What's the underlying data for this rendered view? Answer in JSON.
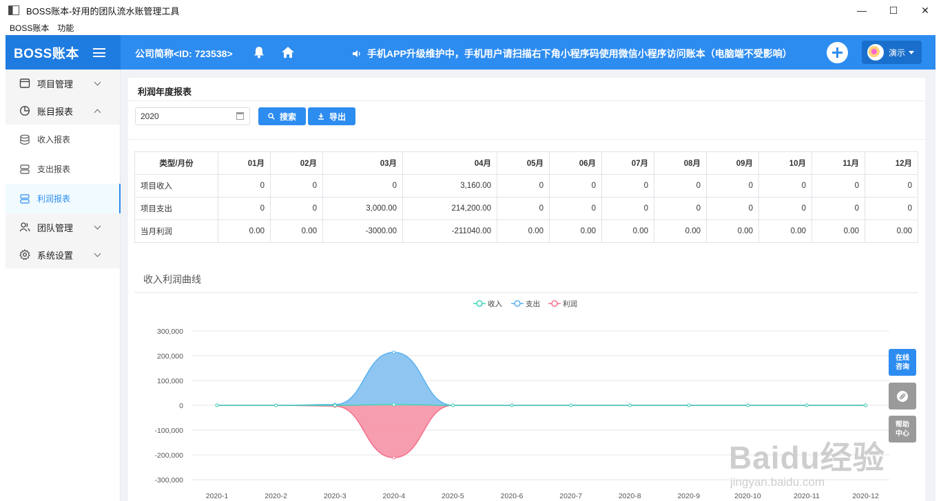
{
  "window": {
    "title": "BOSS账本-好用的团队流水账管理工具",
    "menu": [
      "BOSS账本",
      "功能"
    ],
    "controls": [
      "—",
      "☐",
      "✕"
    ]
  },
  "header": {
    "logo": "BOSS账本",
    "company": "公司简称<ID: 723538>",
    "notice": "手机APP升级维护中，手机用户请扫描右下角小程序码使用微信小程序访问账本（电脑端不受影响）",
    "user": "演示"
  },
  "sidebar": {
    "groups": [
      {
        "label": "项目管理"
      },
      {
        "label": "账目报表"
      },
      {
        "label": "团队管理"
      },
      {
        "label": "系统设置"
      }
    ],
    "sub_items": [
      {
        "label": "收入报表"
      },
      {
        "label": "支出报表"
      },
      {
        "label": "利润报表"
      }
    ]
  },
  "page": {
    "title": "利润年度报表",
    "year_value": "2020",
    "search_label": "搜索",
    "export_label": "导出"
  },
  "table": {
    "headers": [
      "类型/月份",
      "01月",
      "02月",
      "03月",
      "04月",
      "05月",
      "06月",
      "07月",
      "08月",
      "09月",
      "10月",
      "11月",
      "12月"
    ],
    "rows": [
      [
        "项目收入",
        "0",
        "0",
        "0",
        "3,160.00",
        "0",
        "0",
        "0",
        "0",
        "0",
        "0",
        "0",
        "0"
      ],
      [
        "项目支出",
        "0",
        "0",
        "3,000.00",
        "214,200.00",
        "0",
        "0",
        "0",
        "0",
        "0",
        "0",
        "0",
        "0"
      ],
      [
        "当月利润",
        "0.00",
        "0.00",
        "-3000.00",
        "-211040.00",
        "0.00",
        "0.00",
        "0.00",
        "0.00",
        "0.00",
        "0.00",
        "0.00",
        "0.00"
      ]
    ]
  },
  "chart_title": "收入利润曲线",
  "chart_data": {
    "type": "area",
    "categories": [
      "2020-1",
      "2020-2",
      "2020-3",
      "2020-4",
      "2020-5",
      "2020-6",
      "2020-7",
      "2020-8",
      "2020-9",
      "2020-10",
      "2020-11",
      "2020-12"
    ],
    "series": [
      {
        "name": "收入",
        "color": "#3fd3b8",
        "values": [
          0,
          0,
          0,
          3160,
          0,
          0,
          0,
          0,
          0,
          0,
          0,
          0
        ]
      },
      {
        "name": "支出",
        "color": "#5ab1ef",
        "values": [
          0,
          0,
          3000,
          214200,
          0,
          0,
          0,
          0,
          0,
          0,
          0,
          0
        ]
      },
      {
        "name": "利润",
        "color": "#f4708b",
        "values": [
          0,
          0,
          -3000,
          -211040,
          0,
          0,
          0,
          0,
          0,
          0,
          0,
          0
        ]
      }
    ],
    "y_ticks": [
      "300,000",
      "200,000",
      "100,000",
      "0",
      "-100,000",
      "-200,000",
      "-300,000"
    ],
    "ylim": [
      -300000,
      300000
    ],
    "legend": "top-center",
    "grid": true
  },
  "float_buttons": {
    "consult": "在线咨询",
    "help": "帮助中心"
  },
  "watermark": {
    "main": "Baidu经验",
    "sub": "jingyan.baidu.com"
  },
  "colors": {
    "primary": "#2d8cf0",
    "income": "#3fd3b8",
    "expense": "#5ab1ef",
    "profit": "#f4708b"
  }
}
